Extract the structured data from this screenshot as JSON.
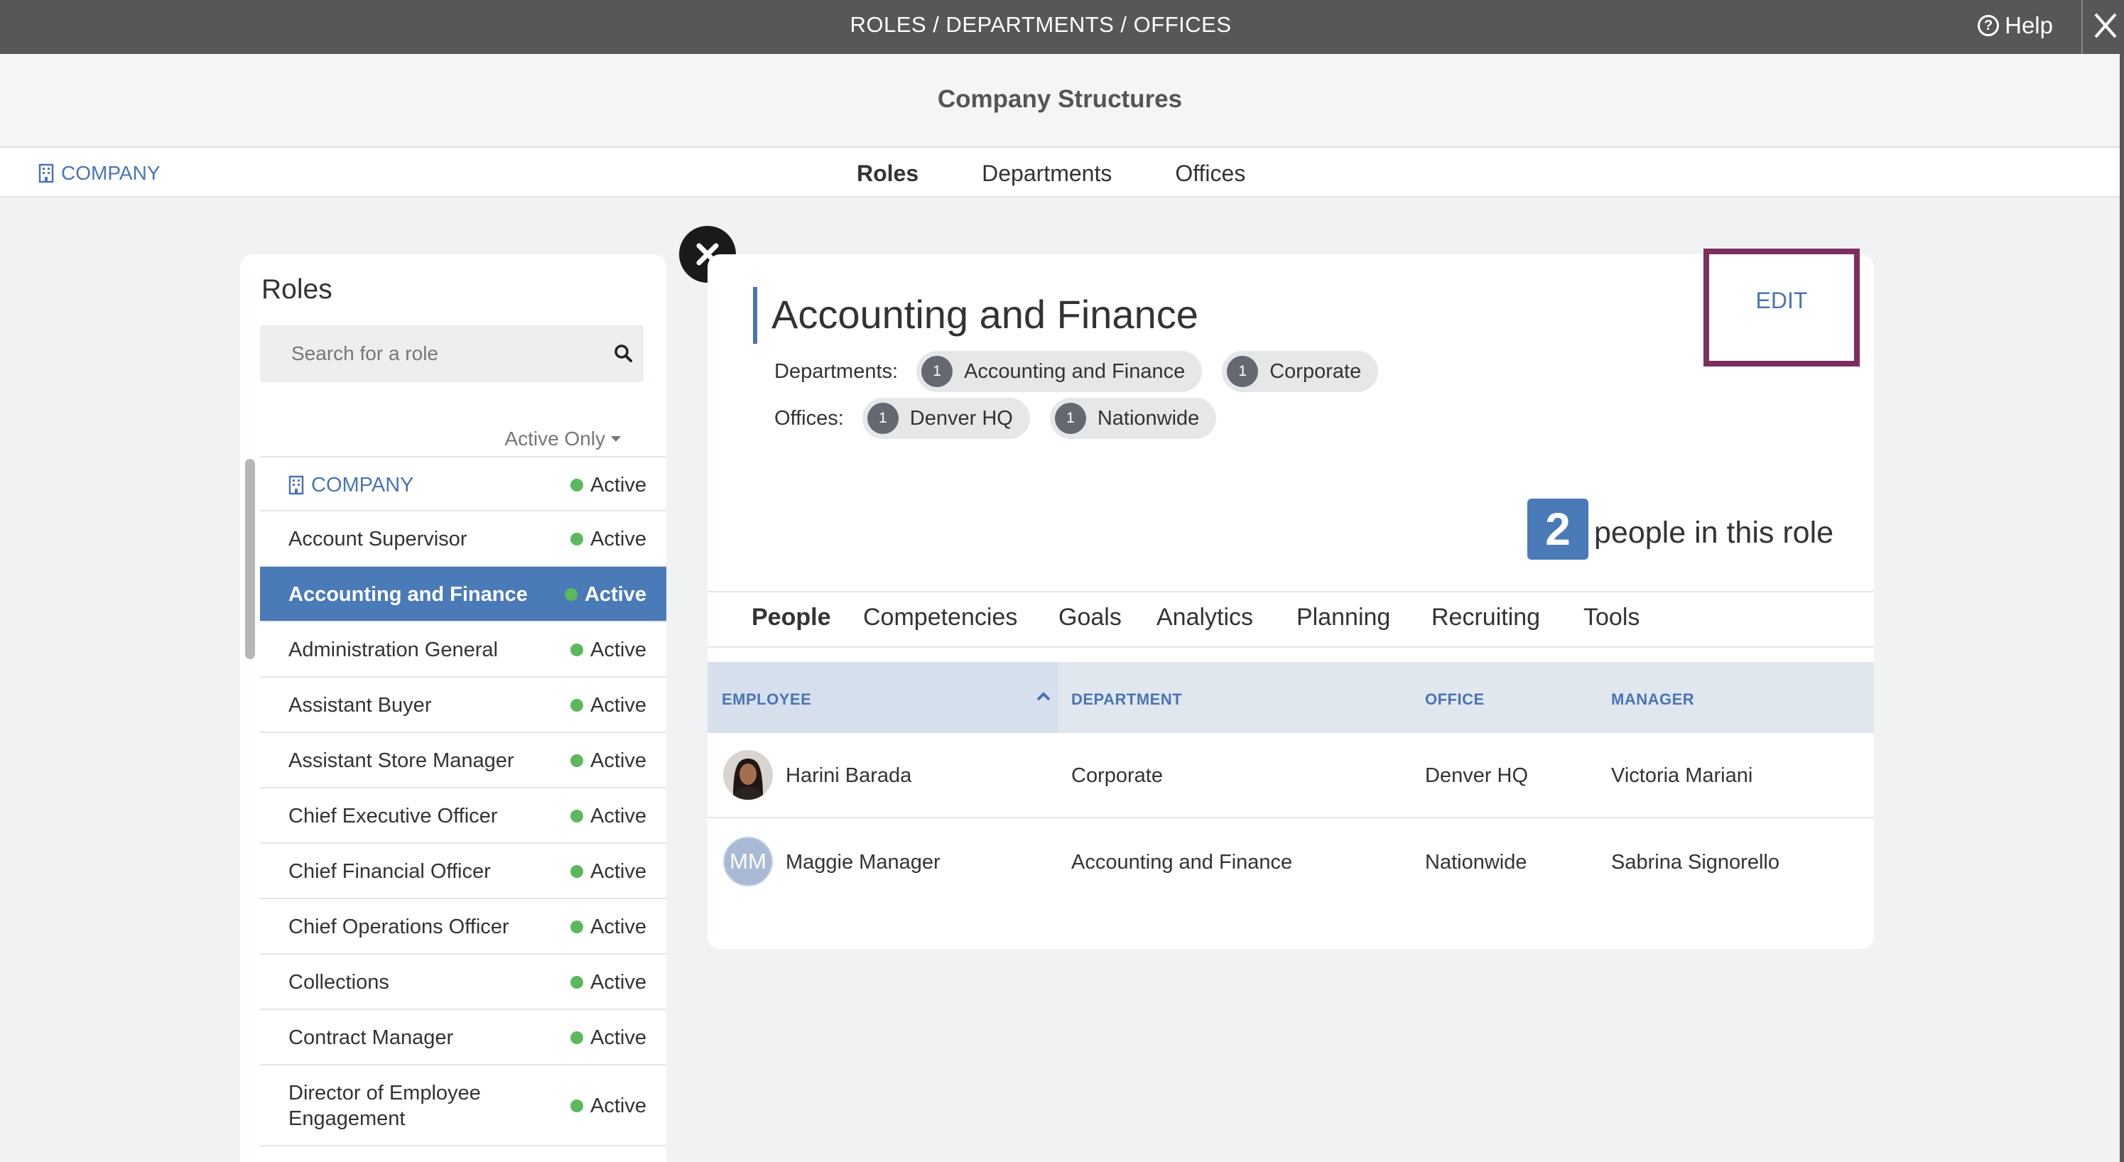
{
  "topbar": {
    "title": "ROLES / DEPARTMENTS / OFFICES",
    "help": "Help"
  },
  "header": {
    "title": "Company Structures"
  },
  "nav": {
    "company_link": "COMPANY",
    "tabs": [
      "Roles",
      "Departments",
      "Offices"
    ],
    "active_tab": "Roles"
  },
  "roles_panel": {
    "title": "Roles",
    "search_placeholder": "Search for a role",
    "filter": "Active Only",
    "items": [
      {
        "name": "COMPANY",
        "status": "Active"
      },
      {
        "name": "Account Supervisor",
        "status": "Active"
      },
      {
        "name": "Accounting and Finance",
        "status": "Active"
      },
      {
        "name": "Administration General",
        "status": "Active"
      },
      {
        "name": "Assistant Buyer",
        "status": "Active"
      },
      {
        "name": "Assistant Store Manager",
        "status": "Active"
      },
      {
        "name": "Chief Executive Officer",
        "status": "Active"
      },
      {
        "name": "Chief Financial Officer",
        "status": "Active"
      },
      {
        "name": "Chief Operations Officer",
        "status": "Active"
      },
      {
        "name": "Collections",
        "status": "Active"
      },
      {
        "name": "Contract Manager",
        "status": "Active"
      },
      {
        "name": "Director of Employee Engagement",
        "status": "Active"
      }
    ],
    "selected": "Accounting and Finance"
  },
  "detail": {
    "title": "Accounting and Finance",
    "edit_label": "EDIT",
    "departments_label": "Departments:",
    "departments": [
      {
        "count": "1",
        "name": "Accounting and Finance"
      },
      {
        "count": "1",
        "name": "Corporate"
      }
    ],
    "offices_label": "Offices:",
    "offices": [
      {
        "count": "1",
        "name": "Denver HQ"
      },
      {
        "count": "1",
        "name": "Nationwide"
      }
    ],
    "people_count": "2",
    "people_text": "people in this role",
    "tabs": [
      "People",
      "Competencies",
      "Goals",
      "Analytics",
      "Planning",
      "Recruiting",
      "Tools"
    ],
    "active_tab": "People",
    "table": {
      "headers": [
        "EMPLOYEE",
        "DEPARTMENT",
        "OFFICE",
        "MANAGER"
      ],
      "rows": [
        {
          "initials": "",
          "employee": "Harini Barada",
          "department": "Corporate",
          "office": "Denver HQ",
          "manager": "Victoria Mariani"
        },
        {
          "initials": "MM",
          "employee": "Maggie Manager",
          "department": "Accounting and Finance",
          "office": "Nationwide",
          "manager": "Sabrina Signorello"
        }
      ]
    }
  },
  "colors": {
    "topbar": "#555759",
    "accent": "#4a74b4",
    "selected_row": "#4a7ab8",
    "status_dot": "#5cb85c",
    "edit_highlight": "#7d2e5e"
  },
  "icons": {
    "help": "question-circle-icon",
    "close": "close-icon",
    "company": "building-icon",
    "search": "search-icon",
    "dismiss": "close-circle-icon",
    "sort": "chevron-up-icon"
  }
}
